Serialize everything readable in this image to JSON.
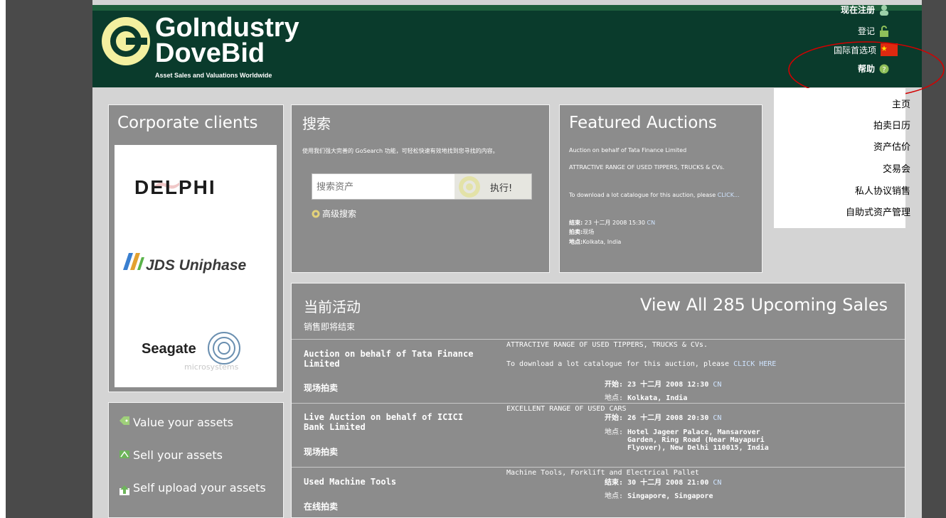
{
  "header": {
    "logo_line1": "GoIndustry",
    "logo_line2": "DoveBid",
    "tagline": "Asset Sales and Valuations Worldwide",
    "register": "现在注册",
    "login": "登记",
    "intl_prefs": "国际首选项",
    "help": "帮助"
  },
  "nav": {
    "items": [
      "主页",
      "拍卖日历",
      "资产估价",
      "交易会",
      "私人协议销售",
      "自助式资产管理"
    ]
  },
  "clients": {
    "title": "Corporate clients",
    "logos": [
      "DELPHI",
      "JDS Uniphase",
      "Seagate",
      "microsystems"
    ]
  },
  "search": {
    "title": "搜索",
    "description": "使用我们强大完善的 GoSearch 功能，可轻松快速有效地找到您寻找的内容。",
    "placeholder": "搜索资产",
    "go_label": "执行!",
    "advanced": "高级搜索"
  },
  "featured": {
    "title": "Featured Auctions",
    "subtitle": "Auction on behalf of Tata Finance Limited",
    "headline": "ATTRACTIVE RANGE OF USED TIPPERS, TRUCKS & CVs.",
    "catalogue": "To download a lot catalogue for this auction, please",
    "click": "CLICK...",
    "end_label": "结束:",
    "end_value": "23 十二月 2008 15:30",
    "cn": "CN",
    "type_label": "拍卖:",
    "type_value": "现场",
    "loc_label": "地点:",
    "loc_value": "Kolkata, India"
  },
  "sidebar_links": {
    "value": "Value your assets",
    "sell": "Sell your assets",
    "upload": "Self upload your assets"
  },
  "activity": {
    "title": "当前活动",
    "subtitle": "销售即将结束",
    "view_all": "View All 285 Upcoming Sales",
    "rows": [
      {
        "title": "Auction on behalf of Tata Finance Limited",
        "type": "现场拍卖",
        "desc": "ATTRACTIVE RANGE OF USED TIPPERS, TRUCKS & CVs.",
        "desc2": "To download a lot catalogue for this auction, please",
        "click": "CLICK HERE",
        "date_label": "开始:",
        "date": "23 十二月 2008 12:30",
        "cn": "CN",
        "loc_label": "地点:",
        "loc": "Kolkata, India"
      },
      {
        "title": "Live Auction on behalf of ICICI Bank Limited",
        "type": "现场拍卖",
        "desc": "EXCELLENT RANGE OF USED CARS",
        "date_label": "开始:",
        "date": "26 十二月 2008 20:30",
        "cn": "CN",
        "loc_label": "地点:",
        "loc": "Hotel Jageer Palace, Mansarover Garden, Ring Road (Near Mayapuri Flyover), New Delhi 110015, India"
      },
      {
        "title": "Used Machine Tools",
        "type": "在线拍卖",
        "desc": "Machine Tools, Forklift and Electrical Pallet",
        "date_label": "结束:",
        "date": "30 十二月 2008 21:00",
        "cn": "CN",
        "loc_label": "地点:",
        "loc": "Singapore, Singapore"
      }
    ]
  },
  "colors": {
    "header_bg": "#0a3b2c",
    "panel_bg": "#8c8c8c",
    "annotation": "#d40000"
  }
}
